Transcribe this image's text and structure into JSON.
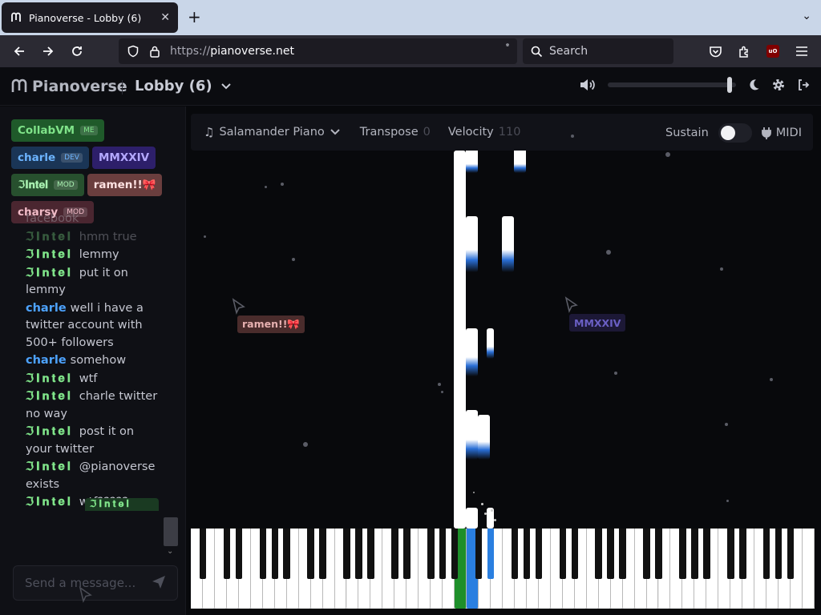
{
  "browser": {
    "tab_title": "Pianoverse - Lobby (6)",
    "close_glyph": "✕",
    "new_tab_glyph": "+",
    "url_prefix": "https://",
    "url_host": "pianoverse.net",
    "search_placeholder": "Search",
    "extension_label": "uO"
  },
  "app": {
    "brand": "Pianoverse",
    "room": "Lobby (6)",
    "volume_level": 0.97
  },
  "users": [
    {
      "name": "CollabVM",
      "badge": "ME",
      "bg": "#1f5a2a",
      "fg": "#7fe389"
    },
    {
      "name": "charle",
      "badge": "DEV",
      "bg": "#1a3556",
      "fg": "#6cb4ff"
    },
    {
      "name": "MMXXIV",
      "badge": "",
      "bg": "#2d1f6a",
      "fg": "#b4a8ff"
    },
    {
      "name": "ℑ𝐈𝐧𝐭𝐞𝐥",
      "badge": "MOD",
      "bg": "#27502e",
      "fg": "#a8f0b0"
    },
    {
      "name": "ramen!!🎀",
      "badge": "",
      "bg": "#6a3e3e",
      "fg": "#ffe2e2"
    },
    {
      "name": "charsy",
      "badge": "MOD",
      "bg": "#4a2630",
      "fg": "#f2bcc8"
    }
  ],
  "chat": [
    {
      "who": "",
      "text": "facebook",
      "faded": true
    },
    {
      "who": "intel",
      "name": "ℑ𝐈𝐧𝐭𝐞𝐥",
      "text": "hmm true",
      "faded": true
    },
    {
      "who": "intel",
      "name": "ℑ𝐈𝐧𝐭𝐞𝐥",
      "text": "lemmy"
    },
    {
      "who": "intel",
      "name": "ℑ𝐈𝐧𝐭𝐞𝐥",
      "text": "put it on lemmy"
    },
    {
      "who": "charle",
      "name": "charle",
      "text": "well i have a twitter account with 500+ followers"
    },
    {
      "who": "charle",
      "name": "charle",
      "text": "somehow"
    },
    {
      "who": "intel",
      "name": "ℑ𝐈𝐧𝐭𝐞𝐥",
      "text": "wtf"
    },
    {
      "who": "intel",
      "name": "ℑ𝐈𝐧𝐭𝐞𝐥",
      "text": "charle twitter no way"
    },
    {
      "who": "intel",
      "name": "ℑ𝐈𝐧𝐭𝐞𝐥",
      "text": "post it on your twitter"
    },
    {
      "who": "intel",
      "name": "ℑ𝐈𝐧𝐭𝐞𝐥",
      "text": "@pianoverse exists"
    },
    {
      "who": "intel",
      "name": "ℑ𝐈𝐧𝐭𝐞𝐥",
      "text": "wtf?????"
    }
  ],
  "chat_input_placeholder": "Send a message...",
  "drag_tag": "ℑ𝐈𝐧𝐭𝐞𝐥",
  "toolbar": {
    "instrument": "Salamander Piano",
    "transpose_label": "Transpose",
    "transpose_value": "0",
    "velocity_label": "Velocity",
    "velocity_value": "110",
    "sustain_label": "Sustain",
    "sustain_on": false,
    "midi_label": "MIDI"
  },
  "cursors": [
    {
      "name": "ramen!!🎀",
      "bg": "#4a2c2c",
      "fg": "#e6b0b0"
    },
    {
      "name": "MMXXIV",
      "bg": "#1c1836",
      "fg": "#6a5fc4"
    }
  ],
  "keyboard": {
    "pressed_green_label": "played-by-CollabVM",
    "pressed_blue_label": "played-by-charle"
  },
  "colors": {
    "accent_green": "#1e8f2a",
    "accent_blue": "#2a7fe0"
  },
  "icons": {
    "back": "arrow-left-icon",
    "forward": "arrow-right-icon",
    "reload": "reload-icon",
    "volume": "volume-icon",
    "theme": "moon-icon",
    "settings": "gear-icon",
    "account": "logout-icon"
  }
}
